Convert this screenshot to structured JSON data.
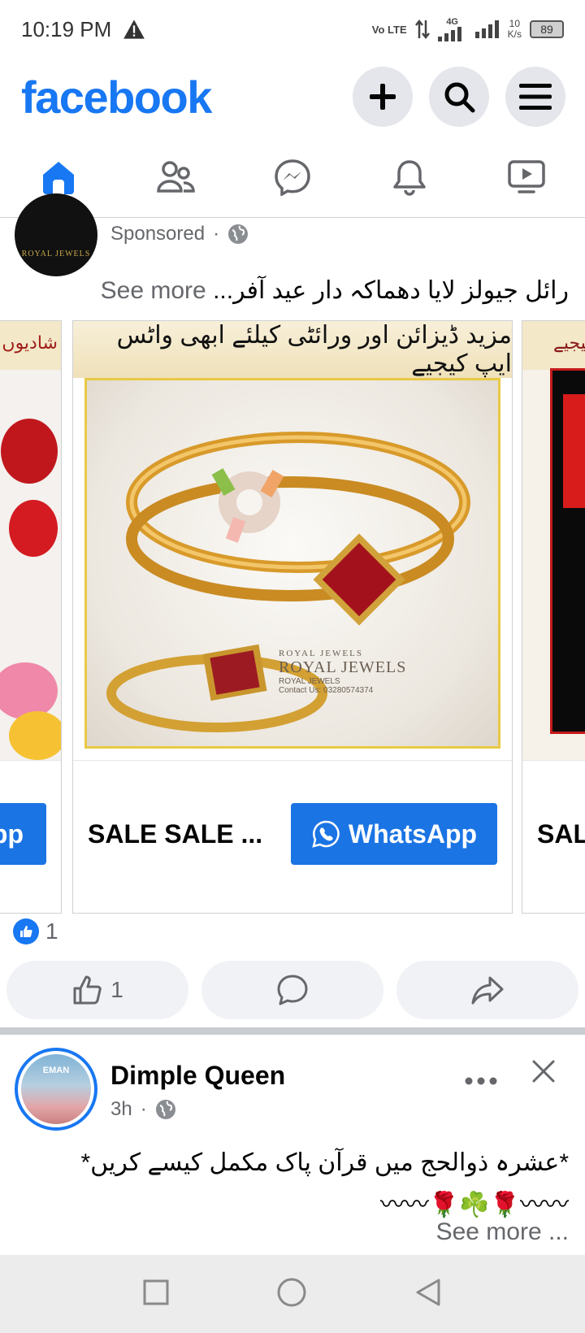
{
  "status_bar": {
    "time": "10:19 PM",
    "network_label": "Vo LTE",
    "network_type": "4G",
    "speed_value": "10",
    "speed_unit": "K/s",
    "battery": "89"
  },
  "header": {
    "logo": "facebook",
    "icons": [
      "plus-icon",
      "search-icon",
      "menu-icon"
    ]
  },
  "nav_tabs": [
    {
      "name": "home",
      "icon": "home-icon",
      "active": true
    },
    {
      "name": "friends",
      "icon": "friends-icon",
      "active": false
    },
    {
      "name": "messenger",
      "icon": "messenger-icon",
      "active": false
    },
    {
      "name": "notifications",
      "icon": "bell-icon",
      "active": false
    },
    {
      "name": "video",
      "icon": "video-icon",
      "active": false
    }
  ],
  "sponsored_post": {
    "page_avatar_text": "ROYAL JEWELS",
    "sponsored_label": "Sponsored",
    "text": "رائل جیولز لایا دھماکہ دار عید آفر...",
    "see_more": "See more",
    "carousel": {
      "left_card": {
        "banner": "شادیوں کے",
        "button": "pp"
      },
      "main_card": {
        "banner": "مزید ڈیزائن اور ورائٹی کیلئے ابھی واٹس ایپ کیجیے",
        "watermark_small": "ROYAL JEWELS",
        "watermark_big": "ROYAL JEWELS",
        "watermark_sub": "ROYAL JEWELS",
        "contact": "Contact Us: 03280574374",
        "title": "SALE SALE ...",
        "button": "WhatsApp"
      },
      "right_card": {
        "banner": "کیجیے",
        "title": "SAL"
      }
    },
    "reaction_count": "1",
    "like_count": "1"
  },
  "second_post": {
    "author": "Dimple Queen",
    "avatar_text": "EMAN",
    "time": "3h",
    "text": "*عشرہ ذوالحج میں  قرآن پاک مکمل کیسے کریں*",
    "emoji_line": "〰〰🌹☘️🌹〰〰",
    "see_more": "See more ..."
  },
  "colors": {
    "brand": "#1877f2",
    "button": "#1b74e4",
    "muted": "#65676b",
    "nav_bg": "#e4e6eb"
  }
}
